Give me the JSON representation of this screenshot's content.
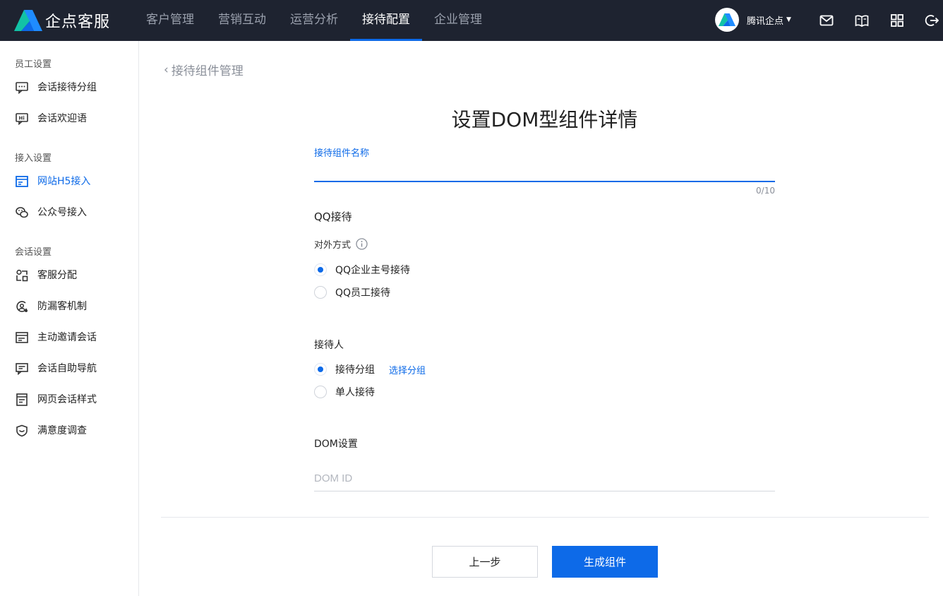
{
  "brand": {
    "name": "企点客服"
  },
  "nav": {
    "items": [
      {
        "label": "客户管理",
        "active": false
      },
      {
        "label": "营销互动",
        "active": false
      },
      {
        "label": "运营分析",
        "active": false
      },
      {
        "label": "接待配置",
        "active": true
      },
      {
        "label": "企业管理",
        "active": false
      }
    ]
  },
  "account": {
    "name": "腾讯企点"
  },
  "header_icons": [
    "mail-icon",
    "book-icon",
    "apps-grid-icon",
    "logout-icon"
  ],
  "sidebar": {
    "groups": [
      {
        "title": "员工设置",
        "items": [
          {
            "label": "会话接待分组",
            "icon": "chat-group-icon"
          },
          {
            "label": "会话欢迎语",
            "icon": "hi-greeting-icon"
          }
        ]
      },
      {
        "title": "接入设置",
        "items": [
          {
            "label": "网站H5接入",
            "icon": "web-window-icon",
            "active": true
          },
          {
            "label": "公众号接入",
            "icon": "wechat-icon"
          }
        ]
      },
      {
        "title": "会话设置",
        "items": [
          {
            "label": "客服分配",
            "icon": "distribution-icon"
          },
          {
            "label": "防漏客机制",
            "icon": "anti-loss-icon"
          },
          {
            "label": "主动邀请会话",
            "icon": "invite-icon"
          },
          {
            "label": "会话自助导航",
            "icon": "self-nav-icon"
          },
          {
            "label": "网页会话样式",
            "icon": "page-style-icon"
          },
          {
            "label": "满意度调查",
            "icon": "satisfaction-icon"
          }
        ]
      }
    ]
  },
  "main": {
    "back_label": "接待组件管理",
    "title": "设置DOM型组件详情",
    "name_field": {
      "label": "接待组件名称",
      "value": "",
      "counter": "0/10"
    },
    "qq": {
      "section_title": "QQ接待",
      "method_label": "对外方式",
      "options": [
        {
          "label": "QQ企业主号接待",
          "checked": true
        },
        {
          "label": "QQ员工接待",
          "checked": false
        }
      ]
    },
    "receiver": {
      "section_title": "接待人",
      "options": [
        {
          "label": "接待分组",
          "checked": true,
          "link": "选择分组"
        },
        {
          "label": "单人接待",
          "checked": false
        }
      ]
    },
    "dom": {
      "section_title": "DOM设置",
      "placeholder": "DOM ID",
      "value": ""
    },
    "buttons": {
      "prev": "上一步",
      "generate": "生成组件"
    }
  },
  "colors": {
    "accent": "#0d6ae8",
    "topbar": "#1e2330"
  }
}
